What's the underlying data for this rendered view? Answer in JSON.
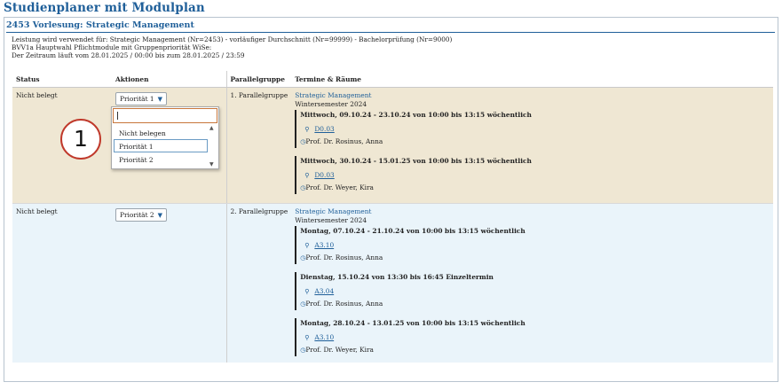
{
  "page_title": "Studienplaner mit Modulplan",
  "box": {
    "header": "2453 Vorlesung: Strategic Management",
    "info_lines": [
      "Leistung wird verwendet für: Strategic Management (Nr=2453) - vorläufiger Durchschnitt (Nr=99999) - Bachelorprüfung (Nr=9000)",
      "BVV1a Hauptwahl Pflichtmodule mit Gruppenpriorität WiSe:",
      "Der Zeitraum läuft vom 28.01.2025 / 00:00 bis zum 28.01.2025 / 23:59"
    ]
  },
  "table": {
    "headers": {
      "status": "Status",
      "actions": "Aktionen",
      "group": "Parallelgruppe",
      "dates": "Termine & Räume"
    },
    "rows": [
      {
        "status": "Nicht belegt",
        "priority": "Priorität 1",
        "group": "1. Parallelgruppe",
        "course_link": "Strategic Management",
        "semester": "Wintersemester 2024",
        "slots": [
          {
            "title": "Mittwoch, 09.10.24 - 23.10.24 von 10:00 bis 13:15 wöchentlich",
            "room": "D0.03",
            "lecturer": "Prof. Dr. Rosinus, Anna"
          },
          {
            "title": "Mittwoch, 30.10.24 - 15.01.25 von 10:00 bis 13:15 wöchentlich",
            "room": "D0.03",
            "lecturer": "Prof. Dr. Weyer, Kira"
          }
        ]
      },
      {
        "status": "Nicht belegt",
        "priority": "Priorität 2",
        "group": "2. Parallelgruppe",
        "course_link": "Strategic Management",
        "semester": "Wintersemester 2024",
        "slots": [
          {
            "title": "Montag, 07.10.24 - 21.10.24 von 10:00 bis 13:15 wöchentlich",
            "room": "A3.10",
            "lecturer": "Prof. Dr. Rosinus, Anna"
          },
          {
            "title": "Dienstag, 15.10.24 von 13:30 bis 16:45 Einzeltermin",
            "room": "A3.04",
            "lecturer": "Prof. Dr. Rosinus, Anna"
          },
          {
            "title": "Montag, 28.10.24 - 13.01.25 von 10:00 bis 13:15 wöchentlich",
            "room": "A3.10",
            "lecturer": "Prof. Dr. Weyer, Kira"
          }
        ]
      }
    ]
  },
  "dropdown": {
    "search_value": "",
    "options": [
      "Nicht belegen",
      "Priorität 1",
      "Priorität 2"
    ],
    "selected": "Priorität 1"
  },
  "annotation_marker": "1",
  "icons": {
    "caret": "chevron-down-icon",
    "room": "map-pin-icon",
    "lecturer": "clock-icon",
    "scroll_up": "scroll-up-icon",
    "scroll_down": "scroll-down-icon"
  },
  "colors": {
    "title": "#1f5f99",
    "row1_bg": "#efe7d3",
    "row2_bg": "#eaf4fa",
    "marker": "#c0392b",
    "focus": "#c8763a"
  }
}
